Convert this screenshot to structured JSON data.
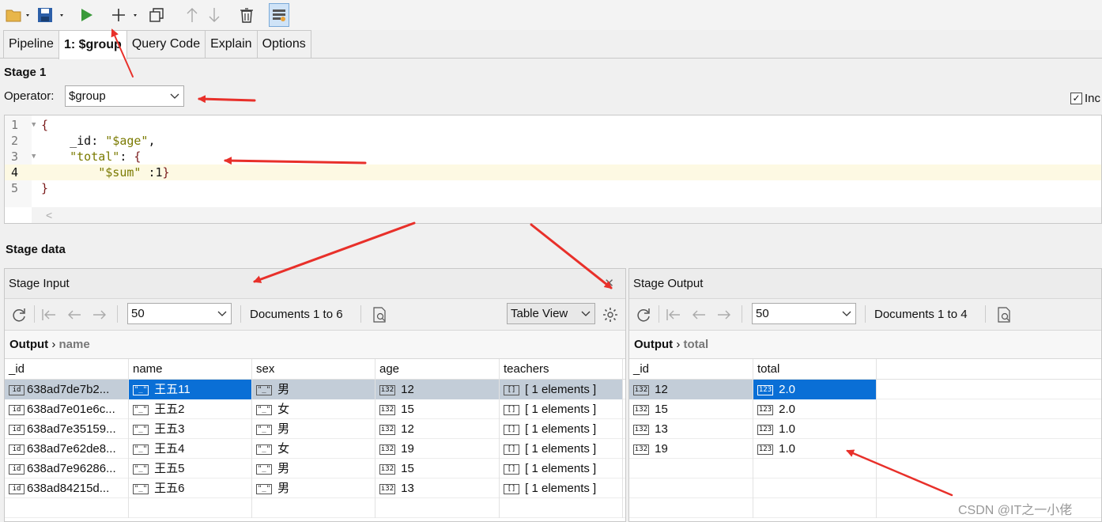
{
  "tabs": [
    "Pipeline",
    "1: $group",
    "Query Code",
    "Explain",
    "Options"
  ],
  "stage": {
    "title": "Stage 1",
    "operator_label": "Operator:",
    "operator_value": "$group",
    "include_label": "Inc"
  },
  "editor": {
    "lines": [
      {
        "num": "1",
        "text": "{"
      },
      {
        "num": "2",
        "text": "    _id: \"$age\","
      },
      {
        "num": "3",
        "text": "    \"total\": {"
      },
      {
        "num": "4",
        "text": "        \"$sum\" :1}"
      },
      {
        "num": "5",
        "text": "}"
      }
    ],
    "current_line": "4"
  },
  "stage_data_title": "Stage data",
  "stage_input": {
    "title": "Stage Input",
    "page_size": "50",
    "docs_label": "Documents 1 to 6",
    "view": "Table View",
    "breadcrumb_root": "Output",
    "breadcrumb_field": "name",
    "columns": [
      "_id",
      "name",
      "sex",
      "age",
      "teachers"
    ],
    "rows": [
      [
        "638ad7de7b2...",
        "王五11",
        "男",
        "12",
        "[ 1 elements ]"
      ],
      [
        "638ad7e01e6c...",
        "王五2",
        "女",
        "15",
        "[ 1 elements ]"
      ],
      [
        "638ad7e35159...",
        "王五3",
        "男",
        "12",
        "[ 1 elements ]"
      ],
      [
        "638ad7e62de8...",
        "王五4",
        "女",
        "19",
        "[ 1 elements ]"
      ],
      [
        "638ad7e96286...",
        "王五5",
        "男",
        "15",
        "[ 1 elements ]"
      ],
      [
        "638ad84215d...",
        "王五6",
        "男",
        "13",
        "[ 1 elements ]"
      ]
    ]
  },
  "stage_output": {
    "title": "Stage Output",
    "page_size": "50",
    "docs_label": "Documents 1 to 4",
    "breadcrumb_root": "Output",
    "breadcrumb_field": "total",
    "columns": [
      "_id",
      "total"
    ],
    "rows": [
      [
        "12",
        "2.0"
      ],
      [
        "15",
        "2.0"
      ],
      [
        "13",
        "1.0"
      ],
      [
        "19",
        "1.0"
      ]
    ]
  },
  "type_icons": {
    "id": "id",
    "string": "\"_\"",
    "int": "i32",
    "array": "[]",
    "double": "123"
  },
  "watermark": "CSDN @IT之一小佬",
  "colors": {
    "selection": "#0a6fd6",
    "arrow": "#e8302a",
    "highlight_line": "#fdf9e3"
  }
}
